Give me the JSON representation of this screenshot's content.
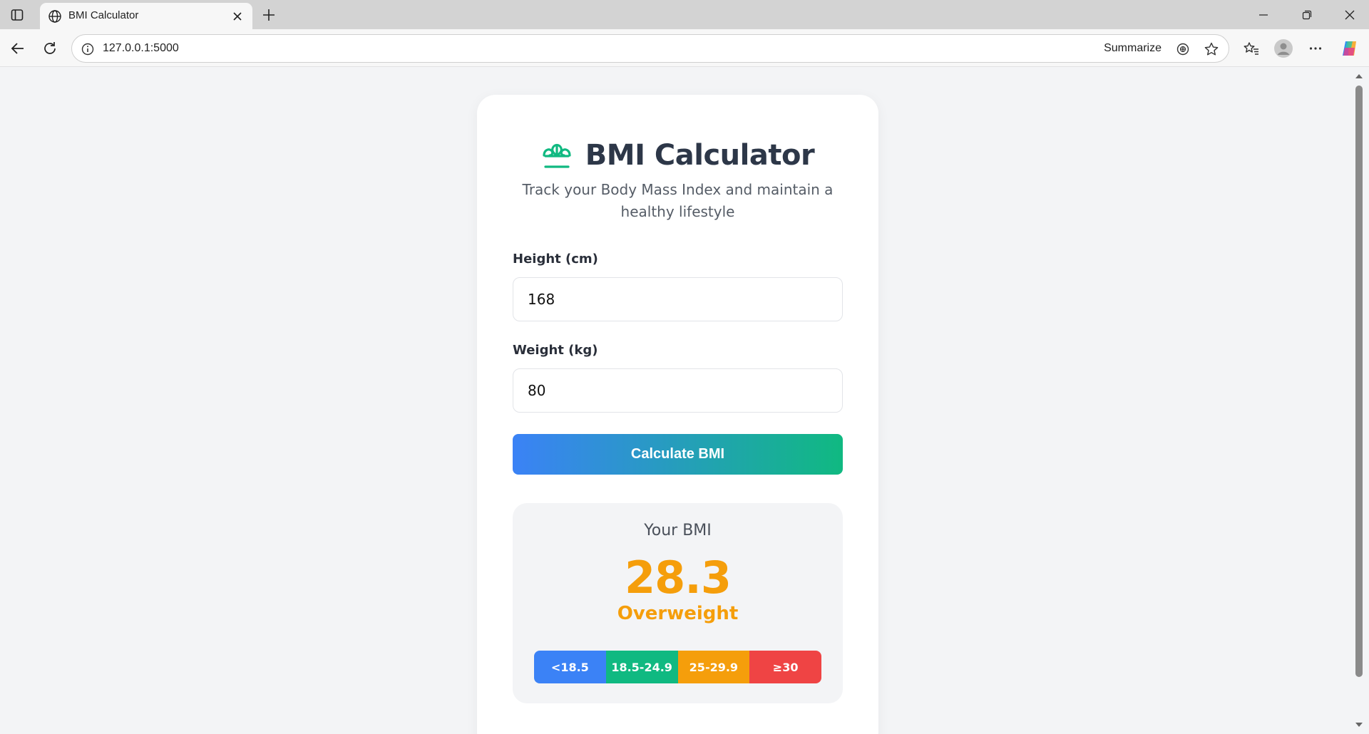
{
  "browser": {
    "tab_title": "BMI Calculator",
    "url": "127.0.0.1:5000",
    "summarize_label": "Summarize",
    "icons": {
      "sidebar": "tab-actions-icon",
      "favicon": "globe-icon",
      "close_tab": "close-icon",
      "new_tab": "plus-icon",
      "back": "back-arrow-icon",
      "reload": "reload-icon",
      "site_info": "info-icon",
      "read_aloud": "read-aloud-icon",
      "favorite": "star-icon",
      "favorites": "favorites-icon",
      "profile": "avatar-icon",
      "more": "more-icon",
      "copilot": "copilot-icon"
    }
  },
  "app": {
    "title": "BMI Calculator",
    "subtitle": "Track your Body Mass Index and maintain a healthy lifestyle",
    "logo_icon": "balance-scale-icon",
    "accent_color": "#10b981"
  },
  "form": {
    "height_label": "Height (cm)",
    "height_value": "168",
    "weight_label": "Weight (kg)",
    "weight_value": "80",
    "submit_label": "Calculate BMI",
    "gradient": [
      "#3b82f6",
      "#10b981"
    ]
  },
  "result": {
    "heading": "Your BMI",
    "value": "28.3",
    "category": "Overweight",
    "category_color": "#f59e0b",
    "scale": [
      {
        "label": "<18.5",
        "color": "#3b82f6"
      },
      {
        "label": "18.5-24.9",
        "color": "#10b981"
      },
      {
        "label": "25-29.9",
        "color": "#f59e0b"
      },
      {
        "label": "≥30",
        "color": "#ef4444"
      }
    ]
  }
}
